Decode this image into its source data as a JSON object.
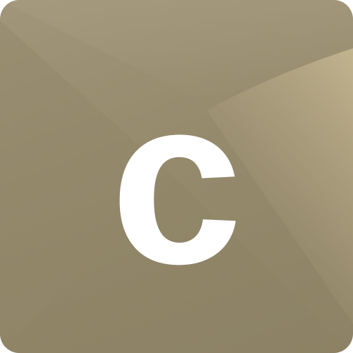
{
  "icon": {
    "letter": "c",
    "colors": {
      "base": "#978b6e",
      "highlight": "#c2b48f",
      "glyph": "#ffffff"
    }
  }
}
